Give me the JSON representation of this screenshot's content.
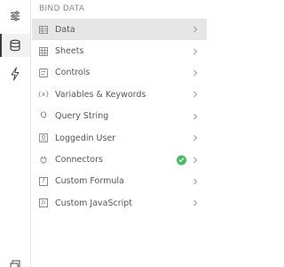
{
  "rail": {
    "items": [
      {
        "icon": "sliders-icon",
        "active": false
      },
      {
        "icon": "database-icon",
        "active": true
      },
      {
        "icon": "bolt-icon",
        "active": false
      },
      {
        "icon": "screen-icon",
        "active": false
      }
    ]
  },
  "panel": {
    "title": "BIND DATA",
    "items": [
      {
        "label": "Data",
        "icon": "grid-icon",
        "selected": true
      },
      {
        "label": "Sheets",
        "icon": "sheet-icon"
      },
      {
        "label": "Controls",
        "icon": "controls-icon"
      },
      {
        "label": "Variables & Keywords",
        "icon": "variable-icon",
        "glyph": "{x}"
      },
      {
        "label": "Query String",
        "icon": "query-icon",
        "glyph": "Q"
      },
      {
        "label": "Loggedin User",
        "icon": "user-icon"
      },
      {
        "label": "Connectors",
        "icon": "plug-icon",
        "status": "connected"
      },
      {
        "label": "Custom Formula",
        "icon": "formula-icon",
        "glyph": "f"
      },
      {
        "label": "Custom JavaScript",
        "icon": "js-icon",
        "glyph": "JS"
      }
    ]
  },
  "colors": {
    "selected_bg": "#e6e6e6",
    "status_green": "#3fbf62",
    "text": "#555555"
  }
}
